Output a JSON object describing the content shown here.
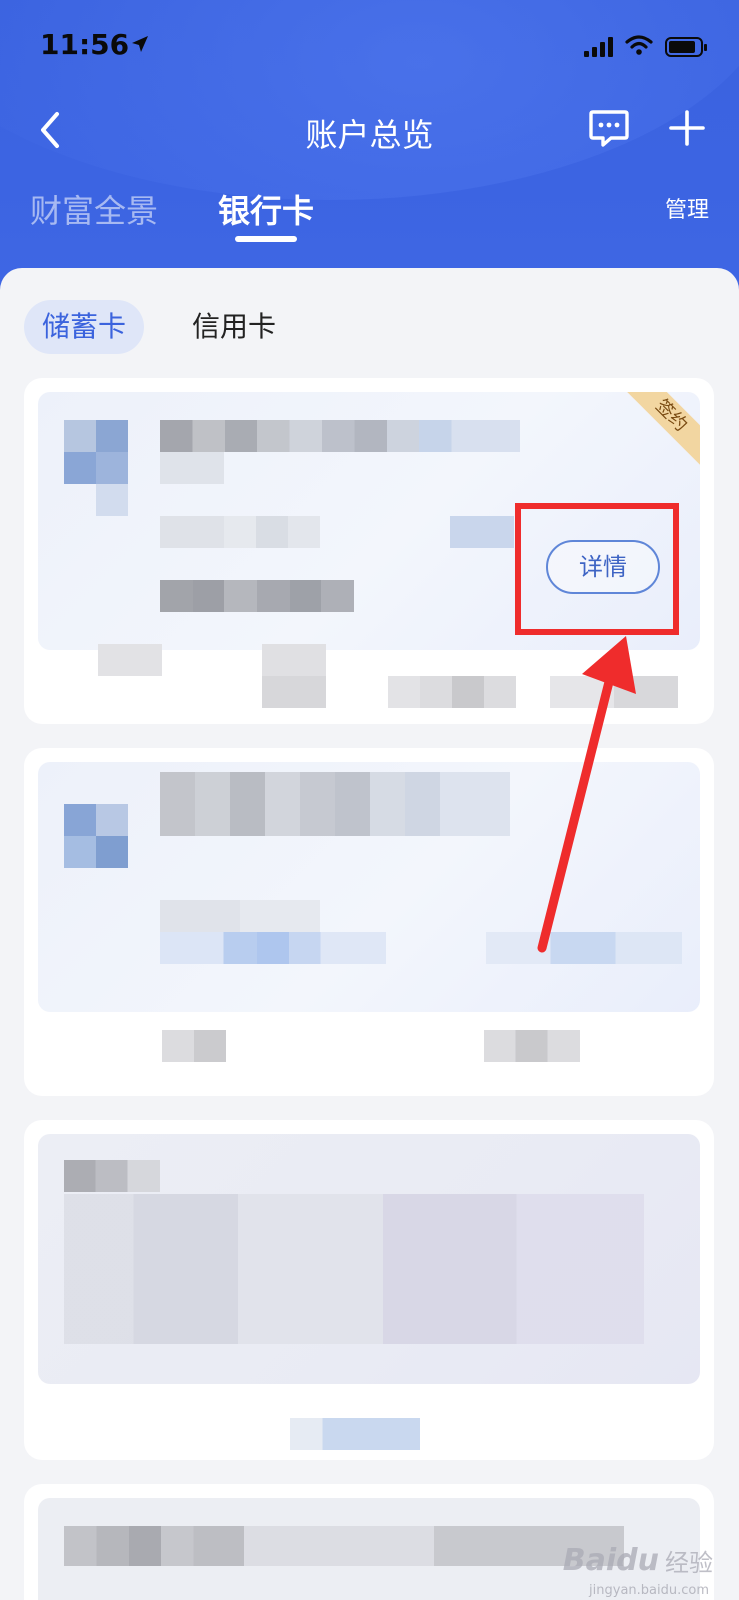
{
  "status_bar": {
    "time": "11:56"
  },
  "nav": {
    "title": "账户总览"
  },
  "tabs": [
    {
      "label": "财富全景"
    },
    {
      "label": "银行卡"
    }
  ],
  "manage_label": "管理",
  "segments": [
    {
      "label": "储蓄卡"
    },
    {
      "label": "信用卡"
    }
  ],
  "card1": {
    "badge": "签约",
    "detail_label": "详情"
  },
  "watermark": {
    "logo": "Baidu",
    "text": "经验",
    "sub": "jingyan.baidu.com"
  },
  "colors": {
    "header_blue": "#3c64e2",
    "accent_blue": "#3b63dd",
    "annotation_red": "#ef2c2c",
    "badge_gold": "#f2d6a1"
  },
  "icons": [
    "location-arrow-icon",
    "signal-icon",
    "wifi-icon",
    "battery-icon",
    "back-chevron-icon",
    "message-icon",
    "plus-icon",
    "annotation-arrow-icon"
  ]
}
